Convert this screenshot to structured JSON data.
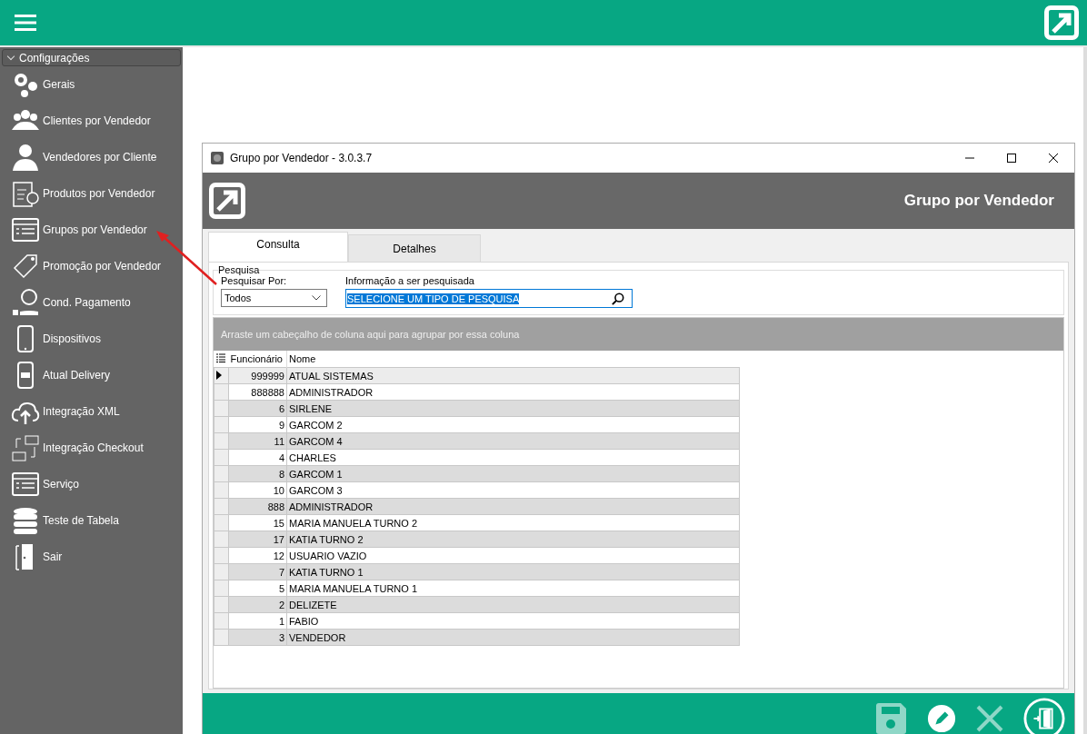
{
  "sidebar": {
    "header": "Configurações",
    "items": [
      {
        "label": "Gerais"
      },
      {
        "label": "Clientes por Vendedor"
      },
      {
        "label": "Vendedores por Cliente"
      },
      {
        "label": "Produtos por Vendedor"
      },
      {
        "label": "Grupos por Vendedor"
      },
      {
        "label": "Promoção por Vendedor"
      },
      {
        "label": "Cond. Pagamento"
      },
      {
        "label": "Dispositivos"
      },
      {
        "label": "Atual Delivery"
      },
      {
        "label": "Integração XML"
      },
      {
        "label": "Integração Checkout"
      },
      {
        "label": "Serviço"
      },
      {
        "label": "Teste de Tabela"
      },
      {
        "label": "Sair"
      }
    ]
  },
  "window": {
    "title": "Grupo por Vendedor - 3.0.3.7",
    "header_title": "Grupo por Vendedor"
  },
  "tabs": [
    {
      "label": "Consulta",
      "selected": true
    },
    {
      "label": "Detalhes",
      "selected": false
    }
  ],
  "search": {
    "group_title": "Pesquisa",
    "by_label": "Pesquisar Por:",
    "by_value": "Todos",
    "info_label": "Informação a ser pesquisada",
    "info_value": "SELECIONE UM TIPO DE PESQUISA"
  },
  "grid": {
    "group_hint": "Arraste um cabeçalho de coluna aqui para agrupar por essa coluna",
    "columns": [
      "Funcionário",
      "Nome"
    ],
    "rows": [
      {
        "id": "999999",
        "name": "ATUAL SISTEMAS",
        "selected": true
      },
      {
        "id": "888888",
        "name": "ADMINISTRADOR",
        "selected": false
      },
      {
        "id": "6",
        "name": "SIRLENE",
        "selected": false
      },
      {
        "id": "9",
        "name": "GARCOM 2",
        "selected": false
      },
      {
        "id": "11",
        "name": "GARCOM 4",
        "selected": false
      },
      {
        "id": "4",
        "name": "CHARLES",
        "selected": false
      },
      {
        "id": "8",
        "name": "GARCOM 1",
        "selected": false
      },
      {
        "id": "10",
        "name": "GARCOM 3",
        "selected": false
      },
      {
        "id": "888",
        "name": "ADMINISTRADOR",
        "selected": false
      },
      {
        "id": "15",
        "name": "MARIA MANUELA TURNO 2",
        "selected": false
      },
      {
        "id": "17",
        "name": "KATIA TURNO 2",
        "selected": false
      },
      {
        "id": "12",
        "name": "USUARIO VAZIO",
        "selected": false
      },
      {
        "id": "7",
        "name": "KATIA TURNO 1",
        "selected": false
      },
      {
        "id": "5",
        "name": "MARIA MANUELA TURNO 1",
        "selected": false
      },
      {
        "id": "2",
        "name": "DELIZETE",
        "selected": false
      },
      {
        "id": "1",
        "name": "FABIO",
        "selected": false
      },
      {
        "id": "3",
        "name": "VENDEDOR",
        "selected": false
      }
    ]
  },
  "toolbar": [
    {
      "kind": "save",
      "disabled": true
    },
    {
      "kind": "edit",
      "disabled": false
    },
    {
      "kind": "cancel",
      "disabled": true
    },
    {
      "kind": "exit",
      "disabled": false
    }
  ]
}
